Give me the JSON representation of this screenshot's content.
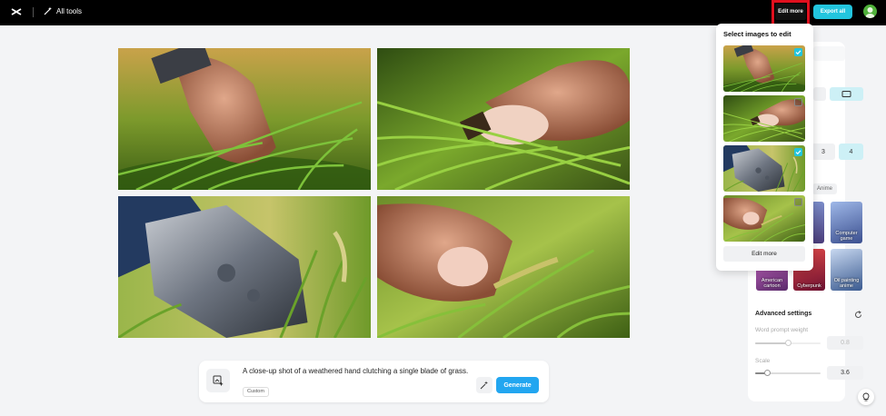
{
  "header": {
    "all_tools_label": "All tools",
    "edit_more_label": "Edit more",
    "export_label": "Export all"
  },
  "images": [
    {
      "subject": "hand picking grass blades"
    },
    {
      "subject": "thumb pressing grass blade"
    },
    {
      "subject": "metal wristband in grass"
    },
    {
      "subject": "fingers holding grass seed head"
    }
  ],
  "prompt": {
    "text": "A close-up shot of a weathered hand clutching a single blade of grass.",
    "tag": "Custom",
    "generate_label": "Generate"
  },
  "popup": {
    "title": "Select images to edit",
    "items": [
      {
        "checked": true
      },
      {
        "checked": false
      },
      {
        "checked": true
      },
      {
        "checked": false
      }
    ],
    "edit_more_label": "Edit more"
  },
  "settings": {
    "count_options": [
      "3",
      "4"
    ],
    "count_selected": "4",
    "style_chip": "Anime",
    "styles": [
      {
        "label": "Computer game"
      },
      {
        "label": "American cartoon"
      },
      {
        "label": "Cyberpunk"
      },
      {
        "label": "Oil painting anime"
      }
    ],
    "advanced_title": "Advanced settings",
    "word_prompt_weight_label": "Word prompt weight",
    "word_prompt_weight_value": "0.8",
    "scale_label": "Scale",
    "scale_value": "3.6"
  },
  "colors": {
    "accent": "#22c5de",
    "generate": "#22a6f0",
    "highlight": "#e0101e"
  }
}
